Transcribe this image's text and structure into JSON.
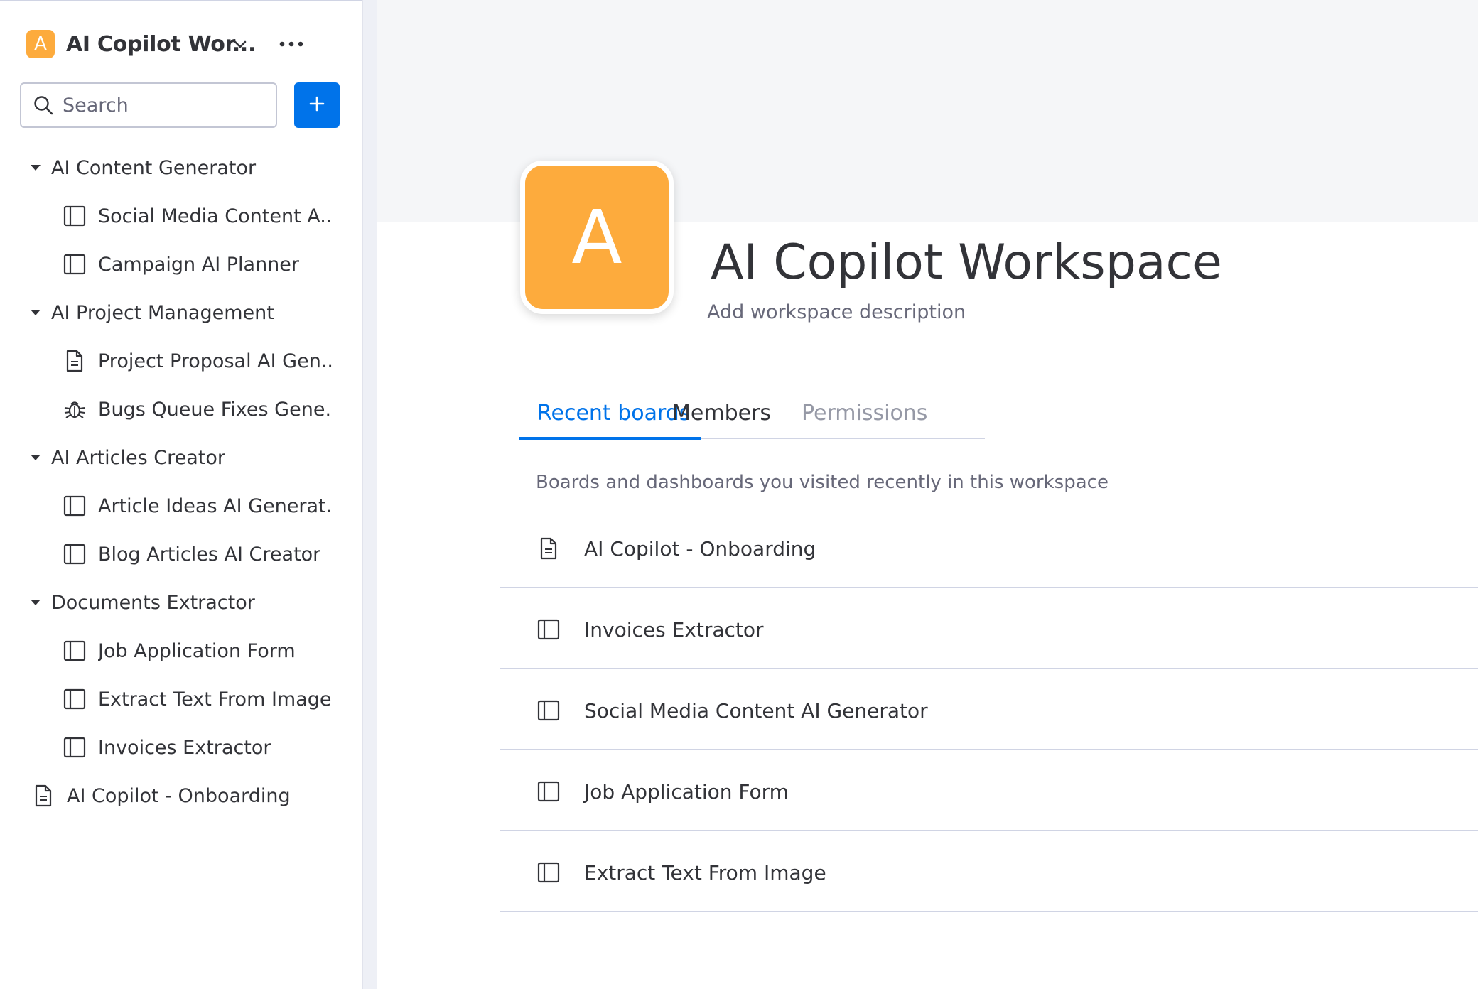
{
  "workspace": {
    "badge_letter": "A",
    "name": "AI Copilot Wor...",
    "full_title": "AI Copilot Workspace",
    "description": "Add workspace description",
    "avatar_letter": "A",
    "brand_color": "#fdab3d",
    "accent_color": "#0073ea"
  },
  "sidebar": {
    "search": {
      "placeholder": "Search",
      "value": ""
    },
    "add_button_icon": "plus-icon",
    "folders": [
      {
        "label": "AI Content Generator",
        "items": [
          {
            "label": "Social Media Content A...",
            "icon": "board-icon"
          },
          {
            "label": "Campaign AI Planner",
            "icon": "board-icon"
          }
        ]
      },
      {
        "label": "AI Project Management",
        "items": [
          {
            "label": "Project Proposal AI Gen...",
            "icon": "doc-icon"
          },
          {
            "label": "Bugs Queue Fixes Gene...",
            "icon": "bug-icon"
          }
        ]
      },
      {
        "label": "AI Articles Creator",
        "items": [
          {
            "label": "Article Ideas AI Generat...",
            "icon": "board-icon"
          },
          {
            "label": "Blog Articles AI Creator",
            "icon": "board-icon"
          }
        ]
      },
      {
        "label": "Documents Extractor",
        "items": [
          {
            "label": "Job Application Form",
            "icon": "board-icon"
          },
          {
            "label": "Extract Text From Image",
            "icon": "board-icon"
          },
          {
            "label": "Invoices Extractor",
            "icon": "board-icon"
          }
        ]
      }
    ],
    "root_items": [
      {
        "label": "AI Copilot - Onboarding",
        "icon": "doc-icon"
      }
    ]
  },
  "main": {
    "tabs": [
      {
        "label": "Recent boards",
        "state": "active"
      },
      {
        "label": "Members",
        "state": "normal"
      },
      {
        "label": "Permissions",
        "state": "disabled"
      }
    ],
    "recent_caption": "Boards and dashboards you visited recently in this workspace",
    "recent_boards": [
      {
        "label": "AI Copilot - Onboarding",
        "icon": "doc-icon"
      },
      {
        "label": "Invoices Extractor",
        "icon": "board-icon"
      },
      {
        "label": "Social Media Content AI Generator",
        "icon": "board-icon"
      },
      {
        "label": "Job Application Form",
        "icon": "board-icon"
      },
      {
        "label": "Extract Text From Image",
        "icon": "board-icon"
      }
    ]
  }
}
